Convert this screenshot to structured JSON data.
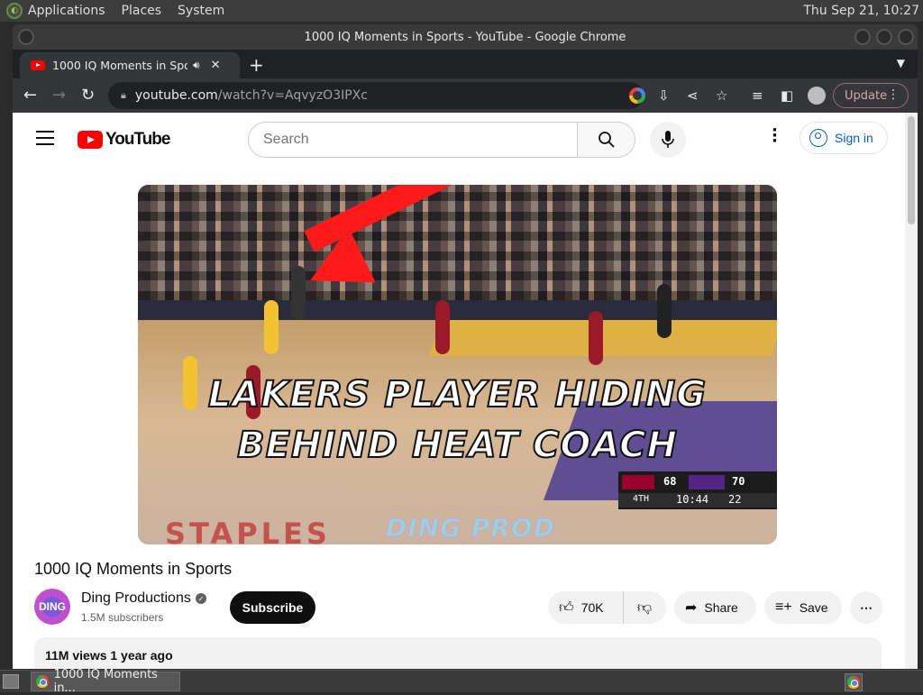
{
  "system_panel": {
    "menus": [
      "Applications",
      "Places",
      "System"
    ],
    "clock": "Thu Sep 21, 10:27"
  },
  "window": {
    "title": "1000 IQ Moments in Sports - YouTube - Google Chrome"
  },
  "tab": {
    "title": "1000 IQ Moments in Sports - YouTube",
    "close": "✕",
    "new_tab": "+",
    "tab_search": "⌄"
  },
  "toolbar": {
    "url_domain": "youtube.com",
    "url_path": "/watch?v=AqvyzO3IPXc",
    "update_label": "Update"
  },
  "youtube": {
    "logo_text": "YouTube",
    "search_placeholder": "Search",
    "signin_label": "Sign in"
  },
  "video": {
    "caption_line1": "LAKERS PLAYER HIDING",
    "caption_line2": "BEHIND HEAT COACH",
    "watermark": "DING PROD",
    "court_text": "STAPLES",
    "scoreboard": {
      "home_score": "68",
      "away_score": "70",
      "quarter": "4TH",
      "clock": "10:44",
      "shot_clock": "22"
    }
  },
  "info": {
    "title": "1000 IQ Moments in Sports",
    "channel_name": "Ding Productions",
    "channel_avatar_text": "DING",
    "subscribers": "1.5M subscribers",
    "subscribe_label": "Subscribe",
    "likes": "70K",
    "share_label": "Share",
    "save_label": "Save",
    "views_line": "11M views  1 year ago"
  },
  "taskbar": {
    "task_label": "1000 IQ Moments in..."
  },
  "colors": {
    "yt_red": "#ff0000",
    "link_blue": "#065fd4",
    "chrome_dark": "#35363a"
  }
}
